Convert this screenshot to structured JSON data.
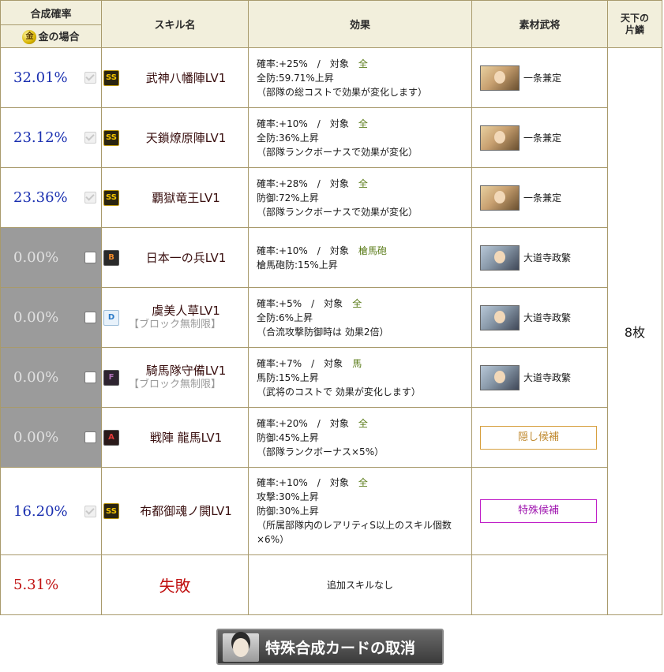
{
  "header": {
    "rate_label": "合成確率",
    "gold_case_label": "金の場合",
    "gold_icon_char": "金",
    "skill_name_label": "スキル名",
    "effect_label": "効果",
    "material_label": "素材武将",
    "shard_label_1": "天下の",
    "shard_label_2": "片鱗"
  },
  "shard_count": "8枚",
  "rows": [
    {
      "rate": "32.01%",
      "checked": true,
      "disabled": false,
      "rank": "SS",
      "skill": "武神八幡陣LV1",
      "skill_sub": "",
      "effect_line1": "確率:+25%　/　対象　",
      "effect_target": "全",
      "effect_line2": "全防:59.71%上昇",
      "effect_line3": "（部隊の総コストで効果が変化します）",
      "effect_line4": "",
      "material": "一条兼定",
      "portrait": "p1"
    },
    {
      "rate": "23.12%",
      "checked": true,
      "disabled": false,
      "rank": "SS",
      "skill": "天鎖燎原陣LV1",
      "skill_sub": "",
      "effect_line1": "確率:+10%　/　対象　",
      "effect_target": "全",
      "effect_line2": "全防:36%上昇",
      "effect_line3": "（部隊ランクボーナスで効果が変化）",
      "effect_line4": "",
      "material": "一条兼定",
      "portrait": "p1"
    },
    {
      "rate": "23.36%",
      "checked": true,
      "disabled": false,
      "rank": "SS",
      "skill": "覇獄竜王LV1",
      "skill_sub": "",
      "effect_line1": "確率:+28%　/　対象　",
      "effect_target": "全",
      "effect_line2": "防御:72%上昇",
      "effect_line3": "（部隊ランクボーナスで効果が変化）",
      "effect_line4": "",
      "material": "一条兼定",
      "portrait": "p1"
    },
    {
      "rate": "0.00%",
      "checked": false,
      "disabled": true,
      "rank": "B",
      "skill": "日本一の兵LV1",
      "skill_sub": "",
      "effect_line1": "確率:+10%　/　対象　",
      "effect_target": "槍馬砲",
      "effect_line2": "槍馬砲防:15%上昇",
      "effect_line3": "",
      "effect_line4": "",
      "material": "大道寺政繁",
      "portrait": "p2"
    },
    {
      "rate": "0.00%",
      "checked": false,
      "disabled": true,
      "rank": "D",
      "skill": "虞美人草LV1",
      "skill_sub": "【ブロック無制限】",
      "effect_line1": "確率:+5%　/　対象　",
      "effect_target": "全",
      "effect_line2": "全防:6%上昇",
      "effect_line3": "（合流攻撃防御時は 効果2倍）",
      "effect_line4": "",
      "material": "大道寺政繁",
      "portrait": "p2"
    },
    {
      "rate": "0.00%",
      "checked": false,
      "disabled": true,
      "rank": "F",
      "skill": "騎馬隊守備LV1",
      "skill_sub": "【ブロック無制限】",
      "effect_line1": "確率:+7%　/　対象　",
      "effect_target": "馬",
      "effect_line2": "馬防:15%上昇",
      "effect_line3": "（武将のコストで 効果が変化します）",
      "effect_line4": "",
      "material": "大道寺政繁",
      "portrait": "p2"
    },
    {
      "rate": "0.00%",
      "checked": false,
      "disabled": true,
      "rank": "A",
      "skill": "戦陣 龍馬LV1",
      "skill_sub": "",
      "effect_line1": "確率:+20%　/　対象　",
      "effect_target": "全",
      "effect_line2": "防御:45%上昇",
      "effect_line3": "（部隊ランクボーナス×5%）",
      "effect_line4": "",
      "material_button": "隠し候補",
      "material_button_kind": "hidden-c"
    },
    {
      "rate": "16.20%",
      "checked": true,
      "disabled": false,
      "rank": "SS",
      "skill": "布都御魂ノ閧LV1",
      "skill_sub": "",
      "effect_line1": "確率:+10%　/　対象　",
      "effect_target": "全",
      "effect_line2": "攻撃:30%上昇",
      "effect_line3": "防御:30%上昇",
      "effect_line4": "（所属部隊内のレアリティS以上のスキル個数×6%）",
      "material_button": "特殊候補",
      "material_button_kind": "special"
    }
  ],
  "fail_row": {
    "rate": "5.31%",
    "skill": "失敗",
    "effect": "追加スキルなし"
  },
  "cancel_button_label": "特殊合成カードの取消"
}
